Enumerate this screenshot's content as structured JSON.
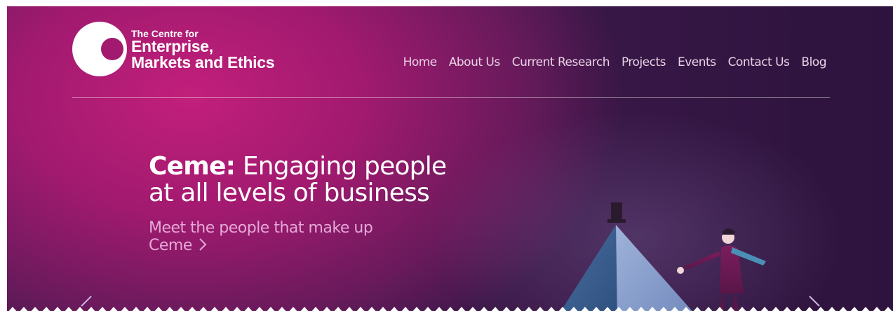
{
  "brand": {
    "line1": "The Centre for",
    "line2": "Enterprise,",
    "line3": "Markets and Ethics",
    "icon": "ceme-logo-mark"
  },
  "nav": {
    "items": [
      {
        "label": "Home"
      },
      {
        "label": "About Us"
      },
      {
        "label": "Current Research"
      },
      {
        "label": "Projects"
      },
      {
        "label": "Events"
      },
      {
        "label": "Contact Us"
      },
      {
        "label": "Blog"
      }
    ]
  },
  "hero": {
    "title_bold": "Ceme:",
    "title_rest": " Engaging people",
    "title_line2": "at all levels of business",
    "subtitle": "Meet the people that make up Ceme",
    "subtitle_icon": "chevron-right-icon",
    "prev_icon": "chevron-left-icon",
    "next_icon": "chevron-right-icon"
  },
  "colors": {
    "hero_magenta": "#c21f7b",
    "hero_deep": "#3a1848",
    "nav_text": "#e8d2e6",
    "subtitle_text": "#e6a8d8"
  }
}
